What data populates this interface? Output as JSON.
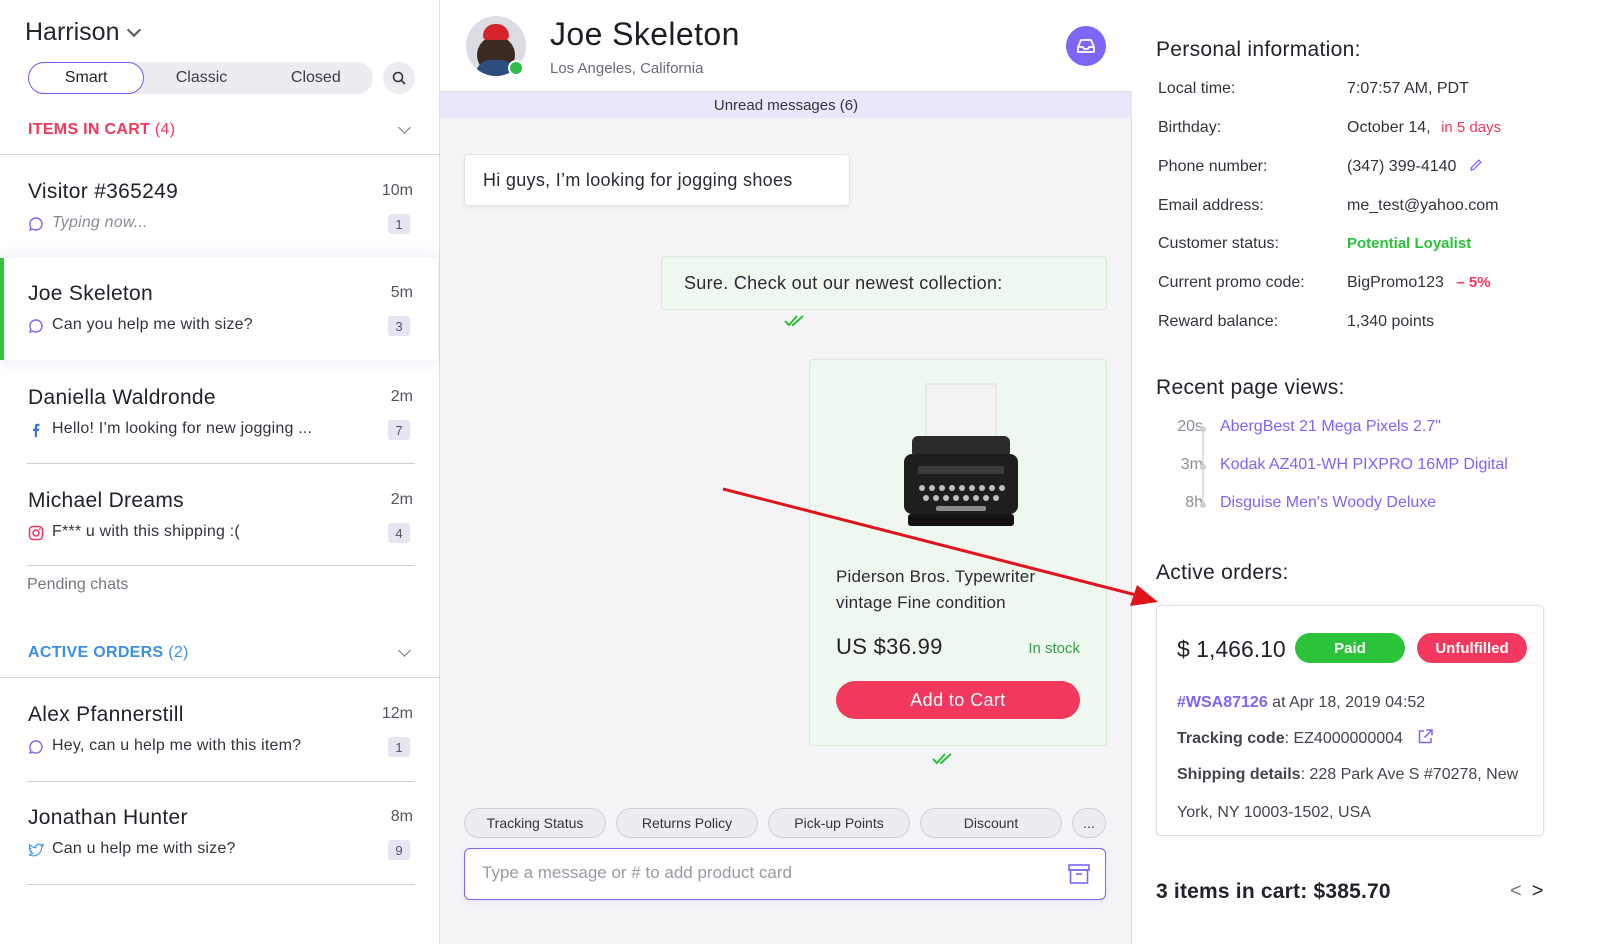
{
  "left": {
    "agent_name": "Harrison",
    "segments": [
      "Smart",
      "Classic",
      "Closed"
    ],
    "items_in_cart": {
      "label": "ITEMS IN CART",
      "count": "(4)"
    },
    "active_orders": {
      "label": "ACTIVE ORDERS",
      "count": "(2)"
    },
    "pending_label": "Pending chats",
    "cart_chats": [
      {
        "name": "Visitor #365249",
        "time": "10m",
        "message": "Typing now...",
        "badge": "1",
        "channel": "chat-bubble-icon"
      },
      {
        "name": "Joe Skeleton",
        "time": "5m",
        "message": "Can you help me with size?",
        "badge": "3",
        "channel": "chat-bubble-icon"
      },
      {
        "name": "Daniella Waldronde",
        "time": "2m",
        "message": "Hello! I’m looking for new jogging ...",
        "badge": "7",
        "channel": "facebook-icon"
      },
      {
        "name": "Michael Dreams",
        "time": "2m",
        "message": "F*** u with this shipping :(",
        "badge": "4",
        "channel": "instagram-icon"
      }
    ],
    "order_chats": [
      {
        "name": "Alex Pfannerstill",
        "time": "12m",
        "message": "Hey, can u help me with this item?",
        "badge": "1",
        "channel": "chat-bubble-icon"
      },
      {
        "name": "Jonathan Hunter",
        "time": "8m",
        "message": "Can u help me with size?",
        "badge": "9",
        "channel": "twitter-icon"
      }
    ]
  },
  "middle": {
    "contact_name": "Joe Skeleton",
    "contact_location": "Los Angeles, California",
    "unread": "Unread messages (6)",
    "incoming_message": "Hi guys, I’m looking for jogging shoes",
    "outgoing_message": "Sure. Check out our newest collection:",
    "product": {
      "name": "Piderson Bros. Typewriter vintage Fine condition",
      "price": "US $36.99",
      "stock": "In stock",
      "button": "Add to Cart"
    },
    "quick_replies": [
      "Tracking Status",
      "Returns Policy",
      "Pick-up Points",
      "Discount",
      "..."
    ],
    "input_placeholder": "Type a message or # to add product card"
  },
  "right": {
    "personal_title": "Personal information:",
    "personal": {
      "local_time_label": "Local time:",
      "local_time": "7:07:57 AM, PDT",
      "birthday_label": "Birthday:",
      "birthday": "October 14,",
      "birthday_note": "in 5 days",
      "phone_label": "Phone number:",
      "phone": "(347) 399-4140",
      "email_label": "Email address:",
      "email": "me_test@yahoo.com",
      "status_label": "Customer status:",
      "status": "Potential Loyalist",
      "promo_label": "Current promo code:",
      "promo": "BigPromo123",
      "promo_note": "– 5%",
      "reward_label": "Reward balance:",
      "reward": "1,340 points"
    },
    "recent_title": "Recent page views:",
    "recent_views": [
      {
        "time": "20s",
        "page": "AbergBest 21 Mega Pixels 2.7\""
      },
      {
        "time": "3m",
        "page": "Kodak AZ401-WH PIXPRO 16MP Digital"
      },
      {
        "time": "8h",
        "page": "Disguise Men's Woody Deluxe"
      }
    ],
    "orders_title": "Active orders:",
    "order": {
      "total": "$ 1,466.10",
      "paid": "Paid",
      "fulfillment": "Unfulfilled",
      "id": "#WSA87126",
      "date": " at Apr 18, 2019  04:52",
      "tracking_label": "Tracking code",
      "tracking": ": EZ4000000004",
      "shipping_label": "Shipping details",
      "shipping_1": ": 228 Park Ave S #70278, New",
      "shipping_2": "York, NY 10003-1502, USA"
    },
    "cart_total": "3 items in cart: $385.70",
    "prev": "<",
    "next": ">"
  },
  "colors": {
    "accent": "#7b66f6",
    "pink": "#f2385d",
    "green": "#2cbf3b",
    "active_orders_blue": "#3d8fe0"
  }
}
